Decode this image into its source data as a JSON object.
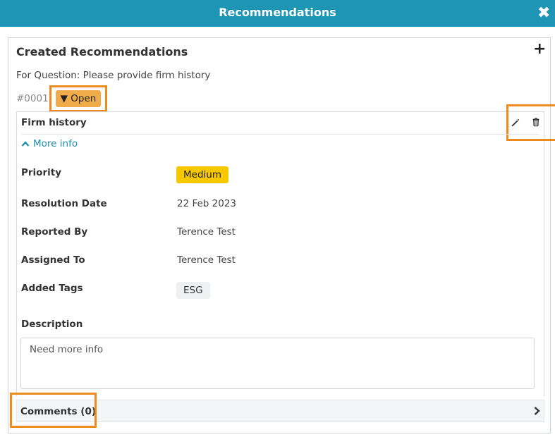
{
  "header": {
    "title": "Recommendations",
    "close_icon": "close-icon",
    "close_glyph": "✖"
  },
  "panel": {
    "title": "Created Recommendations",
    "add_icon": "plus-icon",
    "add_glyph": "+",
    "question": "For Question: Please provide firm history",
    "recommendation_id": "#0001",
    "status": {
      "label": "▼ Open",
      "color": "#f0ac4b"
    }
  },
  "card": {
    "title": "Firm history",
    "edit_icon": "pencil-icon",
    "delete_icon": "trash-icon",
    "more_info_label": "More info",
    "fields": {
      "priority_label": "Priority",
      "priority_value": "Medium",
      "priority_color": "#f7c800",
      "resolution_label": "Resolution Date",
      "resolution_value": "22 Feb 2023",
      "reported_label": "Reported By",
      "reported_value": "Terence Test",
      "assigned_label": "Assigned To",
      "assigned_value": "Terence Test",
      "tags_label": "Added Tags",
      "tags": [
        "ESG"
      ],
      "description_label": "Description",
      "description_value": "Need more info"
    }
  },
  "comments": {
    "label": "Comments (0)",
    "chevron_icon": "chevron-right-icon"
  },
  "colors": {
    "header": "#1e95b5",
    "link": "#1c8fb0",
    "highlight": "#ef8a1c"
  }
}
